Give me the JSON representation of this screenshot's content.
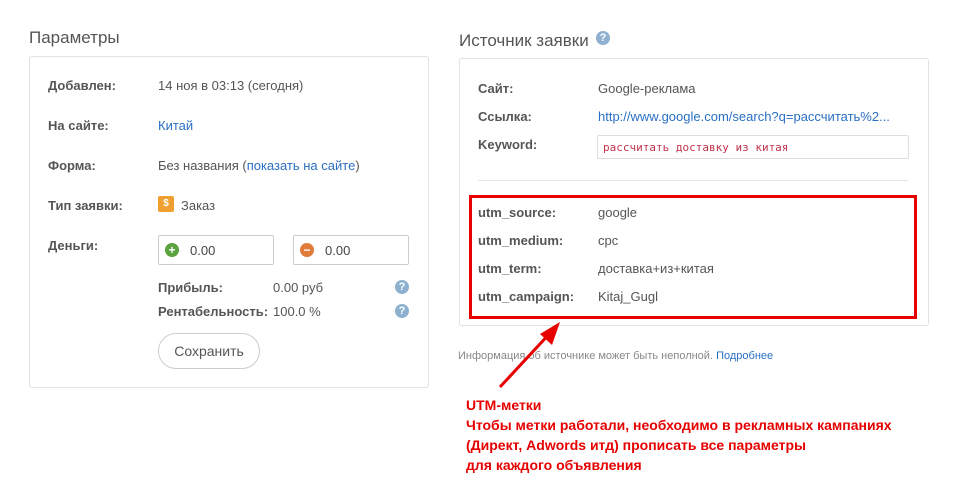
{
  "params": {
    "title": "Параметры",
    "added_label": "Добавлен:",
    "added_value": "14 ноя в 03:13 (сегодня)",
    "site_label": "На сайте:",
    "site_value": "Китай",
    "form_label": "Форма:",
    "form_value_prefix": "Без названия (",
    "form_link": "показать на сайте",
    "form_value_suffix": ")",
    "type_label": "Тип заявки:",
    "type_value": "Заказ",
    "money_label": "Деньги:",
    "income_value": "0.00",
    "expense_value": "0.00",
    "profit_label": "Прибыль:",
    "profit_value": "0.00 руб",
    "profitability_label": "Рентабельность:",
    "profitability_value": "100.0 %",
    "save_label": "Сохранить"
  },
  "source": {
    "title": "Источник заявки",
    "site_label": "Сайт:",
    "site_value": "Google-реклама",
    "link_label": "Ссылка:",
    "link_value": "http://www.google.com/search?q=рассчитать%2...",
    "keyword_label": "Keyword:",
    "keyword_value": "рассчитать доставку из китая",
    "utm": [
      {
        "label": "utm_source:",
        "value": "google"
      },
      {
        "label": "utm_medium:",
        "value": "cpc"
      },
      {
        "label": "utm_term:",
        "value": "доставка+из+китая"
      },
      {
        "label": "utm_campaign:",
        "value": "Kitaj_Gugl"
      }
    ],
    "note_text": "Информация об источнике может быть неполной.",
    "note_link": "Подробнее"
  },
  "annotation": {
    "title": "UTM-метки",
    "lines": [
      "Чтобы метки работали, необходимо в рекламных кампаниях",
      "(Директ, Adwords итд) прописать все параметры",
      "для каждого объявления"
    ]
  },
  "colors": {
    "accent_link": "#2a6fc4",
    "annotation_red": "#e60000",
    "keyword_text": "#c0324a"
  },
  "icons": {
    "help": "question-circle-icon",
    "income": "plus-circle-icon",
    "expense": "minus-circle-icon",
    "order": "order-icon",
    "arrow": "arrow-icon"
  }
}
